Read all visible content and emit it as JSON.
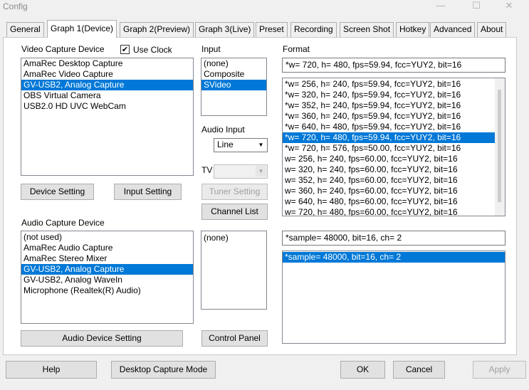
{
  "window": {
    "title": "Config",
    "minimize_glyph": "—",
    "maximize_glyph": "☐",
    "close_glyph": "✕"
  },
  "tabs": [
    {
      "label": "General"
    },
    {
      "label": "Graph 1(Device)"
    },
    {
      "label": "Graph 2(Preview)"
    },
    {
      "label": "Graph 3(Live)"
    },
    {
      "label": "Preset"
    },
    {
      "label": "Recording"
    },
    {
      "label": "Screen Shot"
    },
    {
      "label": "Hotkey"
    },
    {
      "label": "Advanced"
    },
    {
      "label": "About"
    }
  ],
  "video": {
    "label": "Video Capture Device",
    "use_clock_label": "Use Clock",
    "use_clock_checked": "✔",
    "devices": [
      "AmaRec Desktop Capture",
      "AmaRec Video Capture",
      "GV-USB2, Analog Capture",
      "OBS Virtual Camera",
      "USB2.0 HD UVC WebCam"
    ],
    "selected_index": 2,
    "device_setting_label": "Device Setting",
    "input_setting_label": "Input Setting"
  },
  "input": {
    "label": "Input",
    "items": [
      "(none)",
      "Composite",
      "SVideo"
    ],
    "selected_index": 2,
    "audio_input_label": "Audio Input",
    "audio_input_value": "Line",
    "tv_label": "TV",
    "tuner_setting_label": "Tuner Setting",
    "channel_list_label": "Channel List"
  },
  "format": {
    "label": "Format",
    "current": "*w= 720, h= 480, fps=59.94,  fcc=YUY2, bit=16",
    "items": [
      "*w= 256, h= 240, fps=59.94,  fcc=YUY2, bit=16",
      "*w= 320, h= 240, fps=59.94,  fcc=YUY2, bit=16",
      "*w= 352, h= 240, fps=59.94,  fcc=YUY2, bit=16",
      "*w= 360, h= 240, fps=59.94,  fcc=YUY2, bit=16",
      "*w= 640, h= 480, fps=59.94,  fcc=YUY2, bit=16",
      "*w= 720, h= 480, fps=59.94,  fcc=YUY2, bit=16",
      "*w= 720, h= 576, fps=50.00,  fcc=YUY2, bit=16",
      "w= 256, h= 240, fps=60.00,  fcc=YUY2, bit=16",
      "w= 320, h= 240, fps=60.00,  fcc=YUY2, bit=16",
      "w= 352, h= 240, fps=60.00,  fcc=YUY2, bit=16",
      "w= 360, h= 240, fps=60.00,  fcc=YUY2, bit=16",
      "w= 640, h= 480, fps=60.00,  fcc=YUY2, bit=16",
      "w= 720, h= 480, fps=60.00,  fcc=YUY2, bit=16"
    ],
    "selected_index": 5
  },
  "audio": {
    "label": "Audio Capture Device",
    "devices": [
      "(not used)",
      "AmaRec Audio Capture",
      "AmaRec Stereo Mixer",
      "GV-USB2, Analog Capture",
      "GV-USB2, Analog WaveIn",
      "Microphone (Realtek(R) Audio)"
    ],
    "selected_index": 3,
    "input_items": [
      "(none)"
    ],
    "device_setting_label": "Audio Device Setting",
    "control_panel_label": "Control Panel",
    "format_current": "*sample= 48000, bit=16, ch= 2",
    "format_items": [
      "*sample= 48000, bit=16, ch= 2"
    ],
    "format_selected_index": 0
  },
  "footer": {
    "help_label": "Help",
    "desktop_capture_label": "Desktop Capture Mode",
    "ok_label": "OK",
    "cancel_label": "Cancel",
    "apply_label": "Apply"
  },
  "colors": {
    "selection": "#0078d7",
    "panel": "#ffffff",
    "dialog": "#f0f0f0"
  }
}
